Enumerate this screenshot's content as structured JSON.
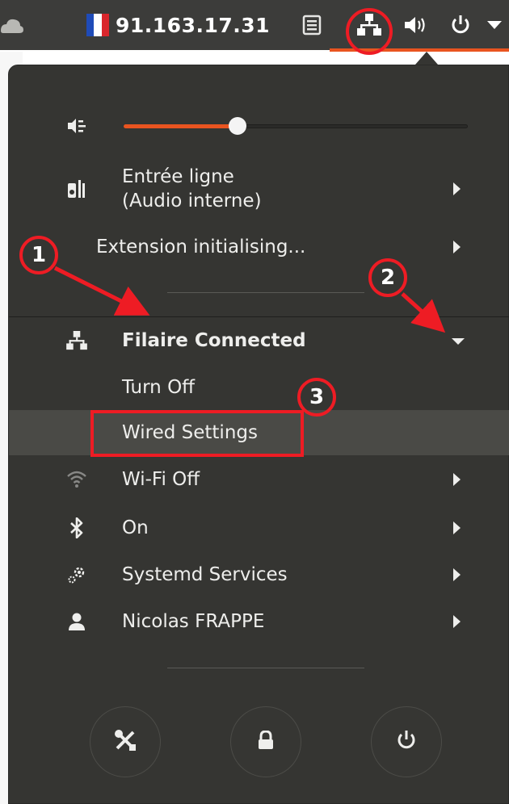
{
  "topbar": {
    "ip_address": "91.163.17.31",
    "icons": [
      "cloud-icon",
      "french-flag-icon",
      "document-icon",
      "network-wired-icon",
      "speaker-volume-icon",
      "power-icon",
      "dropdown-arrow-icon"
    ]
  },
  "menu": {
    "volume": {
      "icon": "audio-input-icon",
      "level": 0.33
    },
    "audio_input": {
      "line1": "Entrée ligne",
      "line2": "(Audio interne)",
      "icon": "audio-device-icon"
    },
    "extension": {
      "label": "Extension initialising..."
    },
    "wired": {
      "label": "Filaire Connected",
      "icon": "network-wired-icon"
    },
    "turn_off": {
      "label": "Turn Off"
    },
    "wired_settings": {
      "label": "Wired Settings"
    },
    "wifi": {
      "label": "Wi-Fi Off",
      "icon": "wifi-icon"
    },
    "bluetooth": {
      "label": "On",
      "icon": "bluetooth-icon"
    },
    "systemd": {
      "label": "Systemd Services",
      "icon": "gears-icon"
    },
    "user": {
      "label": "Nicolas FRAPPE",
      "icon": "user-icon"
    },
    "bottom_buttons": [
      "settings-icon",
      "lock-icon",
      "power-icon"
    ]
  },
  "annotations": {
    "badge1": "1",
    "badge2": "2",
    "badge3": "3",
    "color": "#ee1c24"
  },
  "colors": {
    "accent": "#e95420",
    "panel_bg": "#353532",
    "topbar_bg": "#3c3c3a"
  }
}
